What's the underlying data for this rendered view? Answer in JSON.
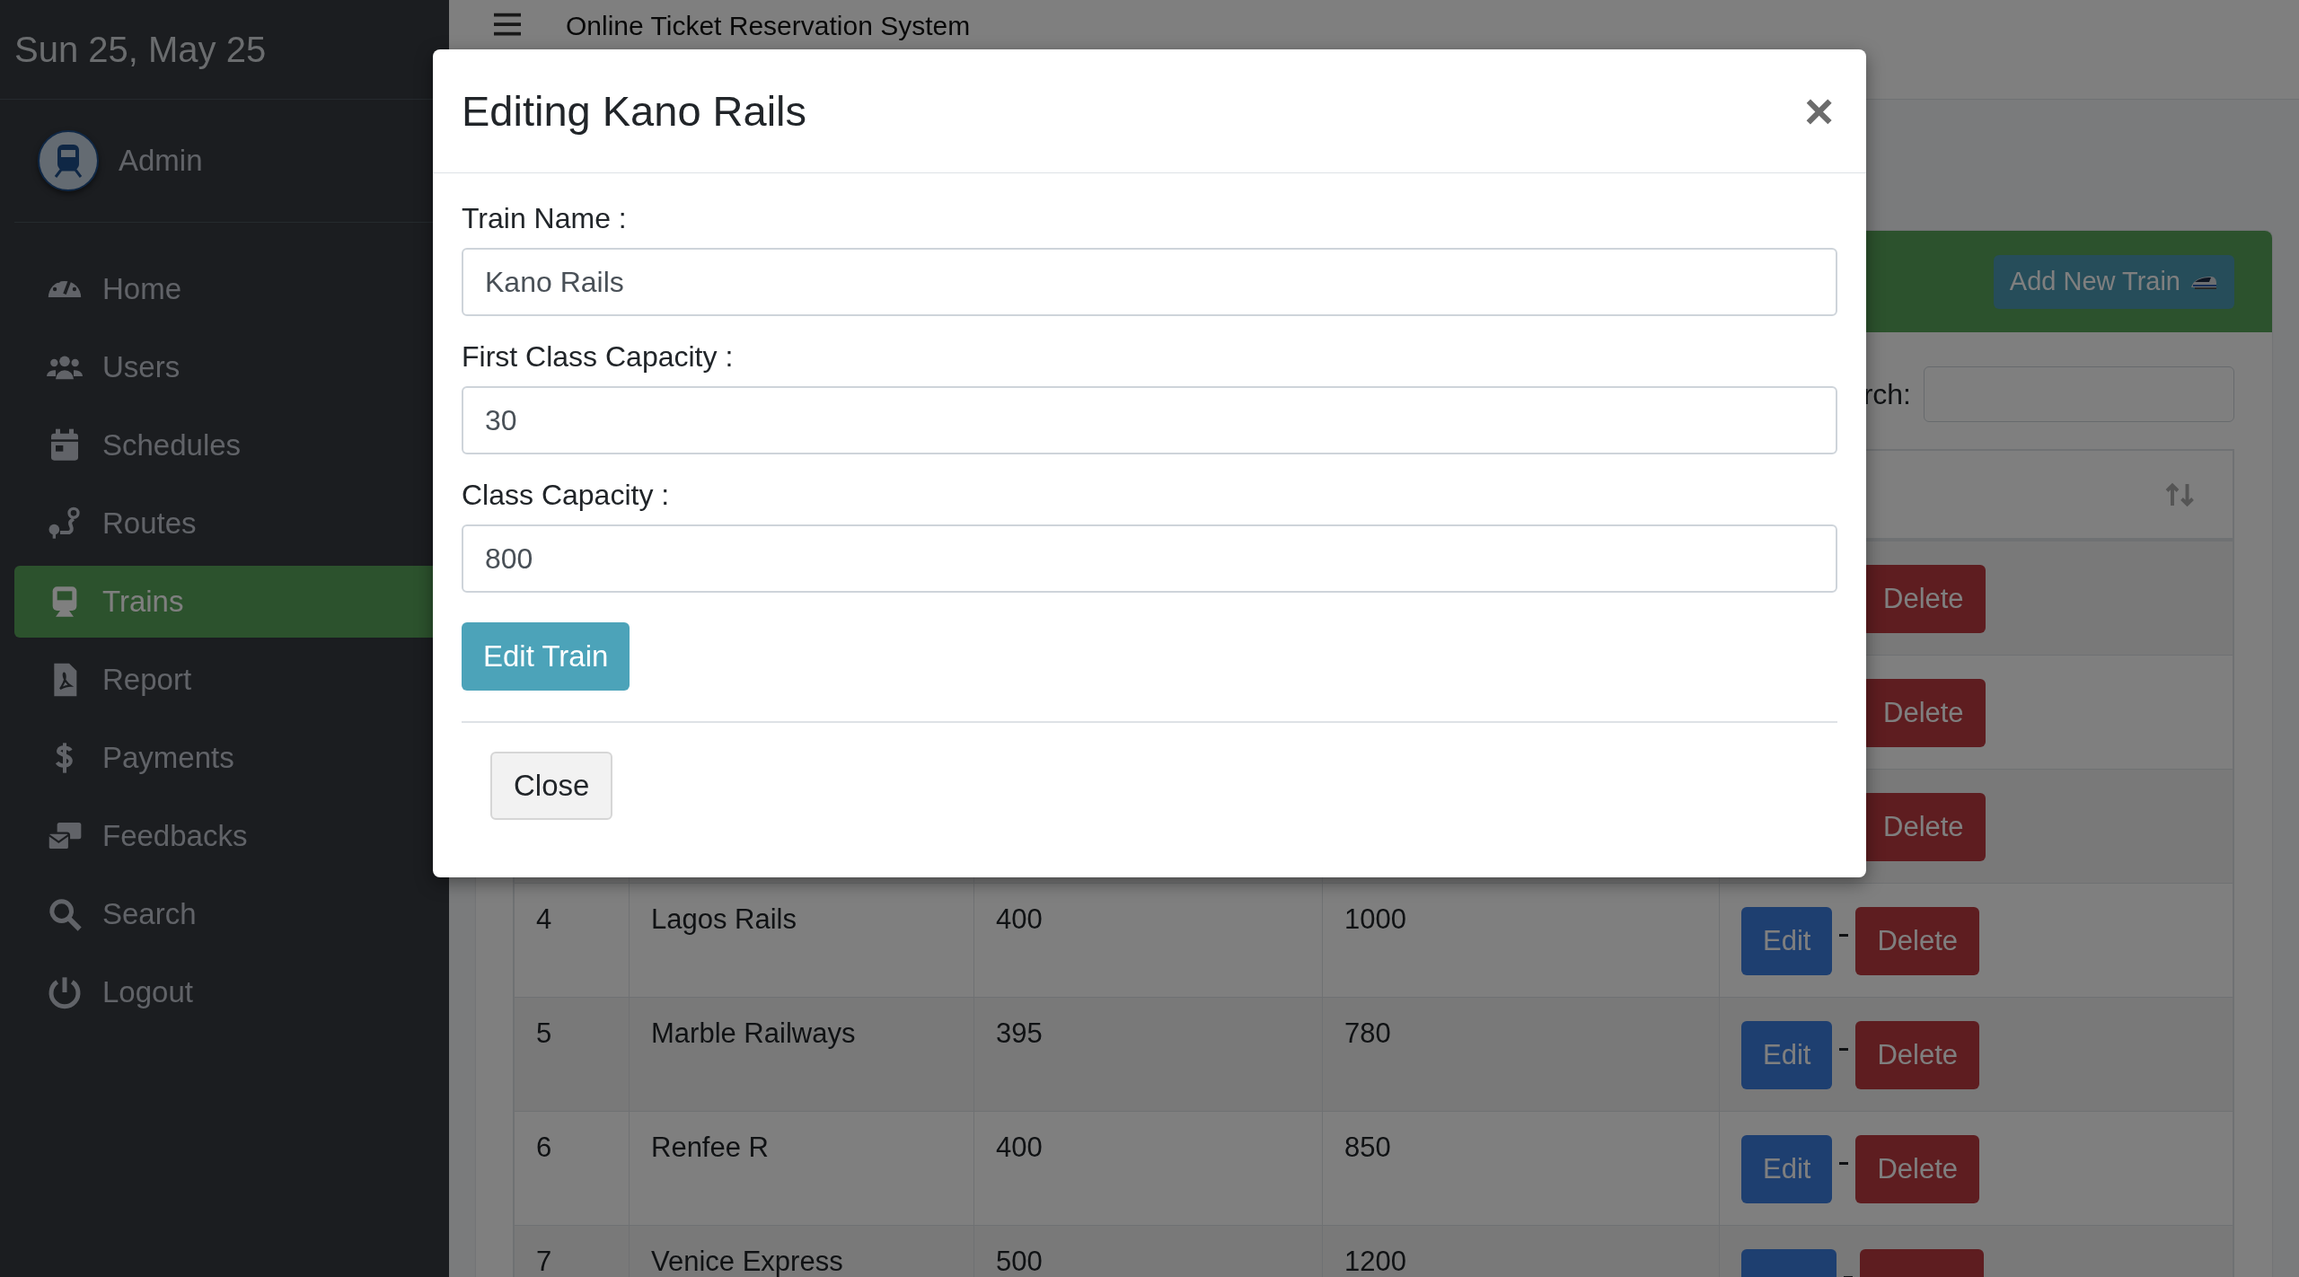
{
  "sidebar": {
    "date": "Sun 25, May 25",
    "user": "Admin",
    "items": [
      {
        "label": "Home",
        "selected": false
      },
      {
        "label": "Users",
        "selected": false
      },
      {
        "label": "Schedules",
        "selected": false
      },
      {
        "label": "Routes",
        "selected": false
      },
      {
        "label": "Trains",
        "selected": true
      },
      {
        "label": "Report",
        "selected": false
      },
      {
        "label": "Payments",
        "selected": false
      },
      {
        "label": "Feedbacks",
        "selected": false
      },
      {
        "label": "Search",
        "selected": false
      },
      {
        "label": "Logout",
        "selected": false
      }
    ]
  },
  "header": {
    "title": "Online Ticket Reservation System"
  },
  "card": {
    "add_button": "Add New Train",
    "search_label": "rch:"
  },
  "table": {
    "rows": [
      {
        "kind": "covered",
        "delete": "Delete"
      },
      {
        "kind": "covered",
        "delete": "Delete"
      },
      {
        "kind": "covered",
        "delete": "Delete"
      },
      {
        "kind": "full",
        "number": "4",
        "name": "Lagos Rails",
        "first_class": "400",
        "class": "1000",
        "edit": "Edit",
        "delete": "Delete"
      },
      {
        "kind": "full",
        "number": "5",
        "name": "Marble Railways",
        "first_class": "395",
        "class": "780",
        "edit": "Edit",
        "delete": "Delete"
      },
      {
        "kind": "full",
        "number": "6",
        "name": "Renfee R",
        "first_class": "400",
        "class": "850",
        "edit": "Edit",
        "delete": "Delete"
      },
      {
        "kind": "partial",
        "number": "7",
        "name": "Venice Express",
        "first_class": "500",
        "class": "1200"
      }
    ]
  },
  "modal": {
    "title": "Editing Kano Rails",
    "close": "×",
    "fields": [
      {
        "label": "Train Name :",
        "value": "Kano Rails"
      },
      {
        "label": "First Class Capacity :",
        "value": "30"
      },
      {
        "label": "Class Capacity :",
        "value": "800"
      }
    ],
    "submit": "Edit Train",
    "footer_button": "Close"
  }
}
